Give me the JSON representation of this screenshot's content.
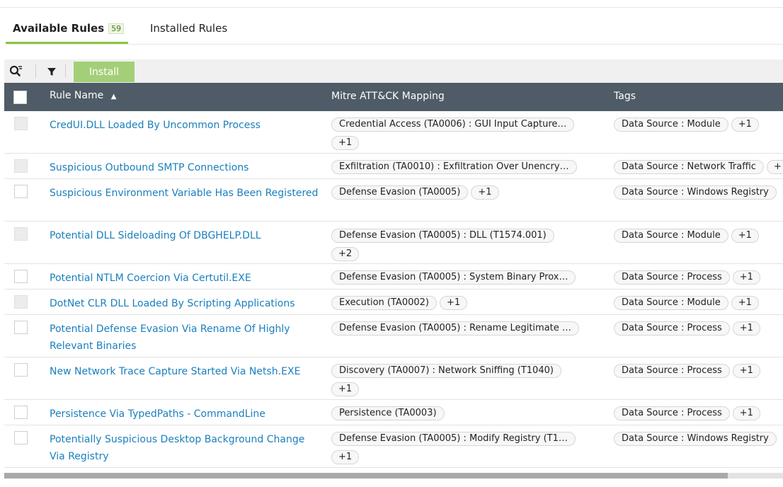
{
  "tabs": [
    {
      "label": "Available Rules",
      "count": "59",
      "active": true
    },
    {
      "label": "Installed Rules",
      "active": false
    }
  ],
  "toolbar": {
    "search_icon": "search-settings-icon",
    "filter_icon": "filter-icon",
    "install_label": "Install",
    "accent_color": "#a3cf78"
  },
  "table": {
    "columns": {
      "rule_name": "Rule Name",
      "sort_indicator": "▲",
      "mitre": "Mitre ATT&CK Mapping",
      "tags": "Tags"
    },
    "rows": [
      {
        "name": "CredUI.DLL Loaded By Uncommon Process",
        "disabled": true,
        "mitre": [
          "Credential Access (TA0006) : GUI Input Capture…"
        ],
        "mitre_more": "+1",
        "tags": [
          "Data Source : Module"
        ],
        "tags_more": "+1"
      },
      {
        "name": "Suspicious Outbound SMTP Connections",
        "disabled": true,
        "mitre": [
          "Exfiltration (TA0010) : Exfiltration Over Unencry…"
        ],
        "mitre_more": "",
        "tags": [
          "Data Source : Network Traffic"
        ],
        "tags_more": "+"
      },
      {
        "name": "Suspicious Environment Variable Has Been Registered",
        "disabled": false,
        "mitre": [
          "Defense Evasion (TA0005)"
        ],
        "mitre_more": "+1",
        "tags": [
          "Data Source : Windows Registry"
        ],
        "tags_more": ""
      },
      {
        "name": "Potential DLL Sideloading Of DBGHELP.DLL",
        "disabled": true,
        "mitre": [
          "Defense Evasion (TA0005) : DLL (T1574.001)"
        ],
        "mitre_more": "+2",
        "tags": [
          "Data Source : Module"
        ],
        "tags_more": "+1"
      },
      {
        "name": "Potential NTLM Coercion Via Certutil.EXE",
        "disabled": false,
        "mitre": [
          "Defense Evasion (TA0005) : System Binary Prox…"
        ],
        "mitre_more": "",
        "tags": [
          "Data Source : Process"
        ],
        "tags_more": "+1"
      },
      {
        "name": "DotNet CLR DLL Loaded By Scripting Applications",
        "disabled": true,
        "mitre": [
          "Execution (TA0002)"
        ],
        "mitre_more": "+1",
        "tags": [
          "Data Source : Module"
        ],
        "tags_more": "+1"
      },
      {
        "name": "Potential Defense Evasion Via Rename Of Highly Relevant Binaries",
        "disabled": false,
        "mitre": [
          "Defense Evasion (TA0005) : Rename Legitimate …"
        ],
        "mitre_more": "",
        "tags": [
          "Data Source : Process"
        ],
        "tags_more": "+1"
      },
      {
        "name": "New Network Trace Capture Started Via Netsh.EXE",
        "disabled": false,
        "mitre": [
          "Discovery (TA0007) : Network Sniffing (T1040)"
        ],
        "mitre_more": "+1",
        "tags": [
          "Data Source : Process"
        ],
        "tags_more": "+1"
      },
      {
        "name": "Persistence Via TypedPaths - CommandLine",
        "disabled": false,
        "mitre": [
          "Persistence (TA0003)"
        ],
        "mitre_more": "",
        "tags": [
          "Data Source : Process"
        ],
        "tags_more": "+1"
      },
      {
        "name": "Potentially Suspicious Desktop Background Change Via Registry",
        "disabled": false,
        "mitre": [
          "Defense Evasion (TA0005) : Modify Registry (T1…"
        ],
        "mitre_more": "+1",
        "tags": [
          "Data Source : Windows Registry"
        ],
        "tags_more": ""
      }
    ]
  }
}
